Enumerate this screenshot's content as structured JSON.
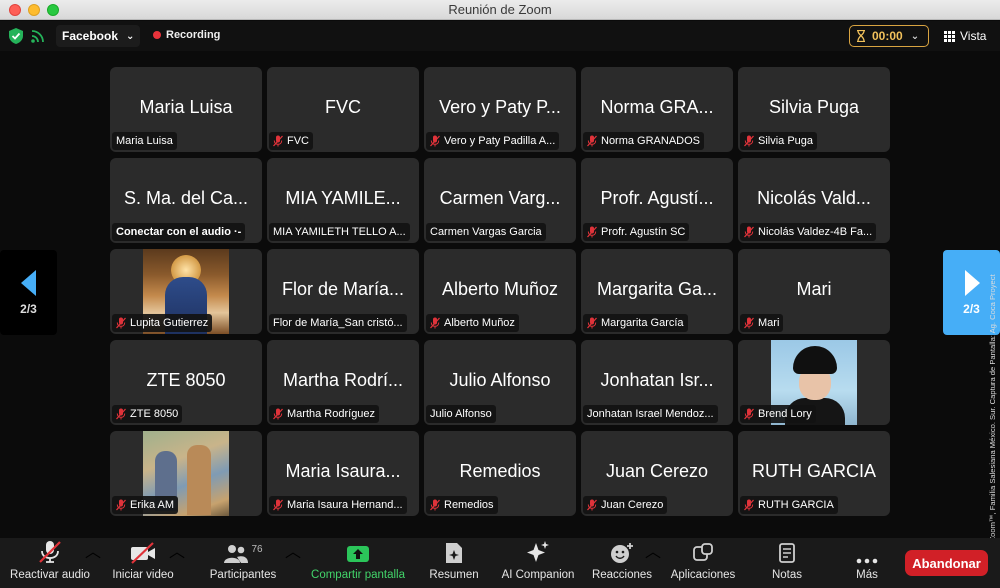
{
  "window": {
    "title": "Reunión de Zoom"
  },
  "topbar": {
    "stream_target": "Facebook",
    "recording_label": "Recording",
    "timer": "00:00",
    "view_label": "Vista"
  },
  "gallery": {
    "tiles": [
      {
        "name": "Maria Luisa",
        "label": "Maria Luisa",
        "muted": false,
        "photo": ""
      },
      {
        "name": "FVC",
        "label": "FVC",
        "muted": true,
        "photo": ""
      },
      {
        "name": "Vero y Paty P...",
        "label": "Vero y Paty Padilla A...",
        "muted": true,
        "photo": ""
      },
      {
        "name": "Norma GRA...",
        "label": "Norma GRANADOS",
        "muted": true,
        "photo": ""
      },
      {
        "name": "Silvia Puga",
        "label": "Silvia Puga",
        "muted": true,
        "photo": ""
      },
      {
        "name": "S. Ma. del Ca...",
        "label": "Conectar con el audio  ·-",
        "muted": false,
        "photo": ""
      },
      {
        "name": "MIA YAMILE...",
        "label": "MIA YAMILETH TELLO A...",
        "muted": false,
        "photo": ""
      },
      {
        "name": "Carmen Varg...",
        "label": "Carmen Vargas Garcia",
        "muted": false,
        "photo": ""
      },
      {
        "name": "Profr. Agustí...",
        "label": "Profr. Agustín SC",
        "muted": true,
        "photo": ""
      },
      {
        "name": "Nicolás Vald...",
        "label": "Nicolás Valdez-4B Fa...",
        "muted": true,
        "photo": ""
      },
      {
        "name": "",
        "label": "Lupita Gutierrez",
        "muted": true,
        "photo": "rosario"
      },
      {
        "name": "Flor de María...",
        "label": "Flor de María_San cristó...",
        "muted": false,
        "photo": ""
      },
      {
        "name": "Alberto Muñoz",
        "label": "Alberto Muñoz",
        "muted": true,
        "photo": ""
      },
      {
        "name": "Margarita Ga...",
        "label": "Margarita García",
        "muted": true,
        "photo": ""
      },
      {
        "name": "Mari",
        "label": "Mari",
        "muted": true,
        "photo": ""
      },
      {
        "name": "ZTE 8050",
        "label": "ZTE 8050",
        "muted": true,
        "photo": ""
      },
      {
        "name": "Martha Rodrí...",
        "label": "Martha Rodríguez",
        "muted": true,
        "photo": ""
      },
      {
        "name": "Julio Alfonso",
        "label": "Julio Alfonso",
        "muted": false,
        "photo": ""
      },
      {
        "name": "Jonhatan Isr...",
        "label": "Jonhatan Israel Mendoz...",
        "muted": false,
        "photo": ""
      },
      {
        "name": "",
        "label": "Brend Lory",
        "muted": true,
        "photo": "brend"
      },
      {
        "name": "",
        "label": "Erika AM",
        "muted": true,
        "photo": "erika"
      },
      {
        "name": "Maria Isaura...",
        "label": "Maria Isaura Hernand...",
        "muted": true,
        "photo": ""
      },
      {
        "name": "Remedios",
        "label": "Remedios",
        "muted": true,
        "photo": ""
      },
      {
        "name": "Juan Cerezo",
        "label": "Juan Cerezo",
        "muted": true,
        "photo": ""
      },
      {
        "name": "RUTH GARCIA",
        "label": "RUTH GARCIA",
        "muted": true,
        "photo": ""
      }
    ]
  },
  "pagination": {
    "left_page": "2/3",
    "right_page": "2/3"
  },
  "caption": "Cortesía © Zoom™, Familia Salesiana México. Sur. Captura de Pantalla: Ag. Coca Proyect",
  "toolbar": {
    "audio": "Reactivar audio",
    "video": "Iniciar video",
    "participants": "Participantes",
    "participants_count": "76",
    "share": "Compartir pantalla",
    "summary": "Resumen",
    "companion": "AI Companion",
    "reactions": "Reacciones",
    "apps": "Aplicaciones",
    "notes": "Notas",
    "more": "Más",
    "leave": "Abandonar"
  },
  "colors": {
    "accent_blue": "#46aef7",
    "share_green": "#42d46a",
    "leave_red": "#d12027",
    "mute_red": "#e0333a",
    "timer_amber": "#f2c25c"
  }
}
